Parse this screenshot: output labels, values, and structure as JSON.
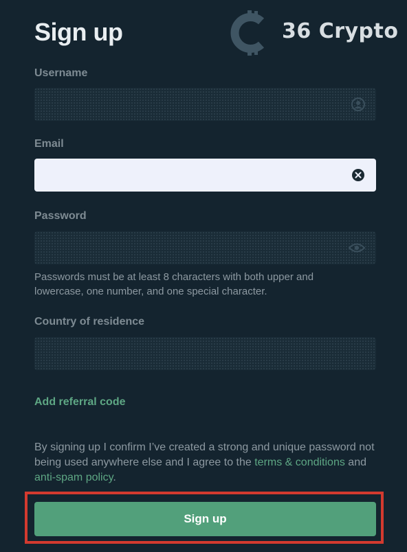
{
  "header": {
    "title": "Sign up",
    "brand_name": "36 Crypto",
    "brand_icon": "bitcoin-c-logo-icon"
  },
  "form": {
    "username": {
      "label": "Username",
      "value": "",
      "placeholder": "",
      "icon": "profile-icon"
    },
    "email": {
      "label": "Email",
      "value": "",
      "placeholder": "",
      "icon": "clear-icon"
    },
    "password": {
      "label": "Password",
      "value": "",
      "placeholder": "",
      "icon": "eye-icon",
      "hint": "Passwords must be at least 8 characters with both upper and lowercase, one number, and one special character."
    },
    "country": {
      "label": "Country of residence",
      "value": ""
    },
    "referral_link": "Add referral code",
    "consent": {
      "text_before": "By signing up I confirm I’ve created a strong and unique password not being used anywhere else and I agree to the ",
      "terms_link": "terms & conditions",
      "and": " and ",
      "antispam_link": "anti-spam policy",
      "text_after": "."
    },
    "submit_label": "Sign up"
  },
  "colors": {
    "background": "#14242f",
    "accent": "#52a07b",
    "link": "#5ea784",
    "highlight": "#d33a2f"
  }
}
